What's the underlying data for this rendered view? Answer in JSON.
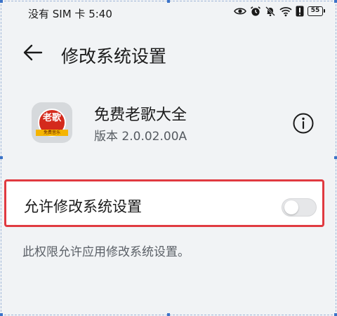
{
  "status_bar": {
    "carrier_time": "没有 SIM 卡 5:40",
    "battery_level": "55",
    "icons": [
      "eye-icon",
      "alarm-icon",
      "mute-bell-icon",
      "wifi-icon",
      "alert-icon",
      "battery-icon"
    ]
  },
  "header": {
    "back_icon": "arrow-left-icon",
    "title": "修改系统设置"
  },
  "app": {
    "icon_text": "老歌",
    "icon_band_text": "免费音乐",
    "name": "免费老歌大全",
    "version": "版本 2.0.02.00A",
    "info_icon": "info-icon"
  },
  "setting": {
    "label": "允许修改系统设置",
    "enabled": false
  },
  "description": "此权限允许应用修改系统设置。",
  "colors": {
    "background": "#f1f3f5",
    "highlight_border": "#e03a40",
    "app_icon_red": "#d42a1c",
    "app_icon_gold": "#f5b400",
    "toggle_off": "#e6e7e9"
  }
}
